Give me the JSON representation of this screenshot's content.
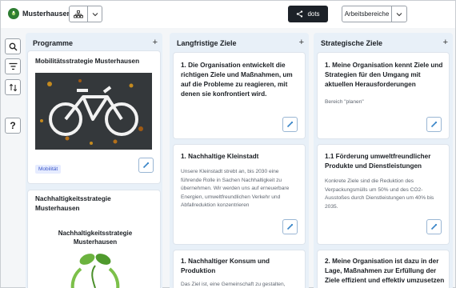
{
  "header": {
    "app_title": "Musterhausen",
    "share_label": "dots",
    "areas_label": "Arbeitsbereiche"
  },
  "tools": [
    "search-icon",
    "filter-icon",
    "sort-icon",
    "help-icon"
  ],
  "columns": [
    {
      "title": "Programme",
      "cards": [
        {
          "title": "Mobilitätsstrategie Musterhausen",
          "tag": "Mobilität"
        },
        {
          "title": "Nachhaltigkeitsstrategie Musterhausen",
          "image_heading": "Nachhaltigkeitsstrategie Musterhausen"
        }
      ]
    },
    {
      "title": "Langfristige Ziele",
      "cards": [
        {
          "title": "1. Die Organisation entwickelt die richtigen Ziele und Maßnahmen, um auf die Probleme zu reagieren, mit denen sie konfrontiert wird."
        },
        {
          "title": "1. Nachhaltige Kleinstadt",
          "text": "Unsere Kleinstadt strebt an, bis 2030 eine führende Rolle in Sachen Nachhaltigkeit zu übernehmen. Wir werden uns auf erneuerbare Energien, umweltfreundlichen Verkehr und Abfallreduktion konzentrieren"
        },
        {
          "title": "1. Nachhaltiger Konsum und Produktion",
          "text": "Das Ziel ist, eine Gemeinschaft zu gestalten,"
        }
      ]
    },
    {
      "title": "Strategische Ziele",
      "cards": [
        {
          "title": "1. Meine Organisation kennt Ziele und Strategien für den Umgang mit aktuellen Herausforderungen",
          "text": "Bereich \"planen\""
        },
        {
          "title": "1.1 Förderung umweltfreundlicher Produkte und Dienstleistungen",
          "text": "Konkrete Ziele sind die Reduktion des Verpackungsmülls um 50% und des CO2-Ausstoßes durch Dienstleistungen um 40% bis 2035."
        },
        {
          "title": "2. Meine Organisation ist dazu in der Lage, Maßnahmen zur Erfüllung der Ziele effizient und effektiv umzusetzen"
        }
      ]
    }
  ],
  "colors": {
    "accent": "#1c2128",
    "column_bg": "#e8f0f8",
    "tag_bg": "#e6ecff",
    "tag_text": "#3b57c9",
    "edit_icon": "#3a86c8"
  }
}
